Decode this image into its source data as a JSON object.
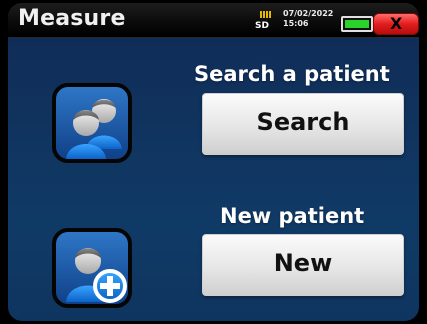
{
  "header": {
    "title": "Measure",
    "storage_label": "SD",
    "date": "07/02/2022",
    "time": "15:06",
    "close_label": "X"
  },
  "actions": {
    "search": {
      "heading": "Search a patient",
      "button_label": "Search"
    },
    "new": {
      "heading": "New patient",
      "button_label": "New"
    }
  },
  "colors": {
    "background": "#103a66",
    "title_bar": "#0b0b0b",
    "close_button": "#e21d1d",
    "battery_fill": "#2bd22b",
    "button_face": "#e6e6e6"
  },
  "icons": [
    "sd-card-icon",
    "battery-icon",
    "close-icon",
    "patients-icon",
    "new-patient-icon"
  ]
}
